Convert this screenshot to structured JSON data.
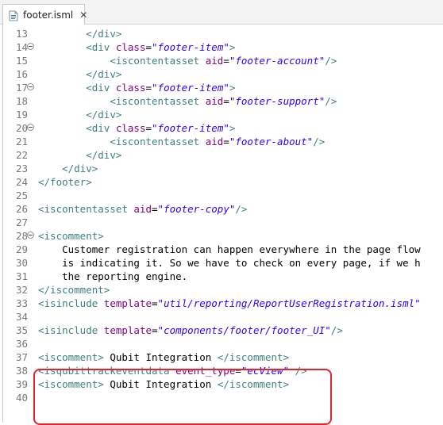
{
  "tab": {
    "label": "footer.isml",
    "close_glyph": "✕",
    "icon": "file-icon"
  },
  "colors": {
    "tag": "#3f7f7f",
    "attribute": "#7f007f",
    "value": "#2a00ff",
    "line_number": "#787878",
    "highlight": "#e0262c"
  },
  "lines": [
    {
      "num": "13",
      "fold": false,
      "segments": [
        {
          "t": "        ",
          "c": "txt"
        },
        {
          "t": "</div>",
          "c": "tag"
        }
      ]
    },
    {
      "num": "14",
      "fold": true,
      "segments": [
        {
          "t": "        ",
          "c": "txt"
        },
        {
          "t": "<div ",
          "c": "tag"
        },
        {
          "t": "class",
          "c": "attr"
        },
        {
          "t": "=",
          "c": "txt"
        },
        {
          "t": "\"footer-item\"",
          "c": "val"
        },
        {
          "t": ">",
          "c": "tag"
        }
      ]
    },
    {
      "num": "15",
      "fold": false,
      "segments": [
        {
          "t": "            ",
          "c": "txt"
        },
        {
          "t": "<iscontentasset ",
          "c": "tag"
        },
        {
          "t": "aid",
          "c": "attr"
        },
        {
          "t": "=",
          "c": "txt"
        },
        {
          "t": "\"footer-account\"",
          "c": "val"
        },
        {
          "t": "/>",
          "c": "tag"
        }
      ]
    },
    {
      "num": "16",
      "fold": false,
      "segments": [
        {
          "t": "        ",
          "c": "txt"
        },
        {
          "t": "</div>",
          "c": "tag"
        }
      ]
    },
    {
      "num": "17",
      "fold": true,
      "segments": [
        {
          "t": "        ",
          "c": "txt"
        },
        {
          "t": "<div ",
          "c": "tag"
        },
        {
          "t": "class",
          "c": "attr"
        },
        {
          "t": "=",
          "c": "txt"
        },
        {
          "t": "\"footer-item\"",
          "c": "val"
        },
        {
          "t": ">",
          "c": "tag"
        }
      ]
    },
    {
      "num": "18",
      "fold": false,
      "segments": [
        {
          "t": "            ",
          "c": "txt"
        },
        {
          "t": "<iscontentasset ",
          "c": "tag"
        },
        {
          "t": "aid",
          "c": "attr"
        },
        {
          "t": "=",
          "c": "txt"
        },
        {
          "t": "\"footer-support\"",
          "c": "val"
        },
        {
          "t": "/>",
          "c": "tag"
        }
      ]
    },
    {
      "num": "19",
      "fold": false,
      "segments": [
        {
          "t": "        ",
          "c": "txt"
        },
        {
          "t": "</div>",
          "c": "tag"
        }
      ]
    },
    {
      "num": "20",
      "fold": true,
      "segments": [
        {
          "t": "        ",
          "c": "txt"
        },
        {
          "t": "<div ",
          "c": "tag"
        },
        {
          "t": "class",
          "c": "attr"
        },
        {
          "t": "=",
          "c": "txt"
        },
        {
          "t": "\"footer-item\"",
          "c": "val"
        },
        {
          "t": ">",
          "c": "tag"
        }
      ]
    },
    {
      "num": "21",
      "fold": false,
      "segments": [
        {
          "t": "            ",
          "c": "txt"
        },
        {
          "t": "<iscontentasset ",
          "c": "tag"
        },
        {
          "t": "aid",
          "c": "attr"
        },
        {
          "t": "=",
          "c": "txt"
        },
        {
          "t": "\"footer-about\"",
          "c": "val"
        },
        {
          "t": "/>",
          "c": "tag"
        }
      ]
    },
    {
      "num": "22",
      "fold": false,
      "segments": [
        {
          "t": "        ",
          "c": "txt"
        },
        {
          "t": "</div>",
          "c": "tag"
        }
      ]
    },
    {
      "num": "23",
      "fold": false,
      "segments": [
        {
          "t": "    ",
          "c": "txt"
        },
        {
          "t": "</div>",
          "c": "tag"
        }
      ]
    },
    {
      "num": "24",
      "fold": false,
      "segments": [
        {
          "t": "</footer>",
          "c": "tag"
        }
      ]
    },
    {
      "num": "25",
      "fold": false,
      "segments": []
    },
    {
      "num": "26",
      "fold": false,
      "segments": [
        {
          "t": "<iscontentasset ",
          "c": "tag"
        },
        {
          "t": "aid",
          "c": "attr"
        },
        {
          "t": "=",
          "c": "txt"
        },
        {
          "t": "\"footer-copy\"",
          "c": "val"
        },
        {
          "t": "/>",
          "c": "tag"
        }
      ]
    },
    {
      "num": "27",
      "fold": false,
      "segments": []
    },
    {
      "num": "28",
      "fold": true,
      "segments": [
        {
          "t": "<iscomment>",
          "c": "tag"
        }
      ]
    },
    {
      "num": "29",
      "fold": false,
      "segments": [
        {
          "t": "    Customer registration can happen everywhere in the page flow",
          "c": "txt"
        }
      ]
    },
    {
      "num": "30",
      "fold": false,
      "segments": [
        {
          "t": "    is indicating it. So we have to check on every page, if we h",
          "c": "txt"
        }
      ]
    },
    {
      "num": "31",
      "fold": false,
      "segments": [
        {
          "t": "    the reporting engine.",
          "c": "txt"
        }
      ]
    },
    {
      "num": "32",
      "fold": false,
      "segments": [
        {
          "t": "</iscomment>",
          "c": "tag"
        }
      ]
    },
    {
      "num": "33",
      "fold": false,
      "segments": [
        {
          "t": "<isinclude ",
          "c": "tag"
        },
        {
          "t": "template",
          "c": "attr"
        },
        {
          "t": "=",
          "c": "txt"
        },
        {
          "t": "\"util/reporting/ReportUserRegistration.isml\"",
          "c": "val"
        }
      ]
    },
    {
      "num": "34",
      "fold": false,
      "segments": []
    },
    {
      "num": "35",
      "fold": false,
      "segments": [
        {
          "t": "<isinclude ",
          "c": "tag"
        },
        {
          "t": "template",
          "c": "attr"
        },
        {
          "t": "=",
          "c": "txt"
        },
        {
          "t": "\"components/footer/footer_UI\"",
          "c": "val"
        },
        {
          "t": "/>",
          "c": "tag"
        }
      ]
    },
    {
      "num": "36",
      "fold": false,
      "segments": []
    },
    {
      "num": "37",
      "fold": false,
      "segments": [
        {
          "t": "<iscomment>",
          "c": "tag"
        },
        {
          "t": " Qubit Integration ",
          "c": "txt"
        },
        {
          "t": "</iscomment>",
          "c": "tag"
        }
      ]
    },
    {
      "num": "38",
      "fold": false,
      "segments": [
        {
          "t": "<isqubittrackeventdata ",
          "c": "tag"
        },
        {
          "t": "event_type",
          "c": "attr"
        },
        {
          "t": "=",
          "c": "txt"
        },
        {
          "t": "\"ecView\"",
          "c": "val"
        },
        {
          "t": " />",
          "c": "tag"
        }
      ]
    },
    {
      "num": "39",
      "fold": false,
      "segments": [
        {
          "t": "<iscomment>",
          "c": "tag"
        },
        {
          "t": " Qubit Integration ",
          "c": "txt"
        },
        {
          "t": "</iscomment>",
          "c": "tag"
        }
      ]
    },
    {
      "num": "40",
      "fold": false,
      "segments": []
    }
  ]
}
